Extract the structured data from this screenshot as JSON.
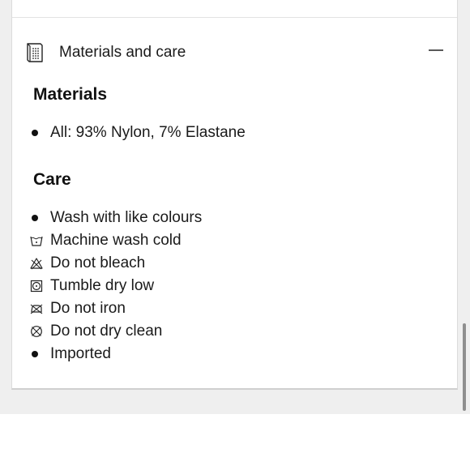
{
  "accordion": {
    "title": "Materials and care",
    "header_icon": "care-label-icon",
    "toggle_icon": "collapse-minus-icon",
    "expanded": true
  },
  "materials": {
    "heading": "Materials",
    "items": [
      {
        "icon": "bullet",
        "text": "All: 93% Nylon, 7% Elastane"
      }
    ]
  },
  "care": {
    "heading": "Care",
    "items": [
      {
        "icon": "bullet",
        "text": "Wash with like colours"
      },
      {
        "icon": "machine-wash-cold-icon",
        "text": "Machine wash cold"
      },
      {
        "icon": "do-not-bleach-icon",
        "text": "Do not bleach"
      },
      {
        "icon": "tumble-dry-low-icon",
        "text": "Tumble dry low"
      },
      {
        "icon": "do-not-iron-icon",
        "text": "Do not iron"
      },
      {
        "icon": "do-not-dry-clean-icon",
        "text": "Do not dry clean"
      },
      {
        "icon": "bullet",
        "text": "Imported"
      }
    ]
  }
}
